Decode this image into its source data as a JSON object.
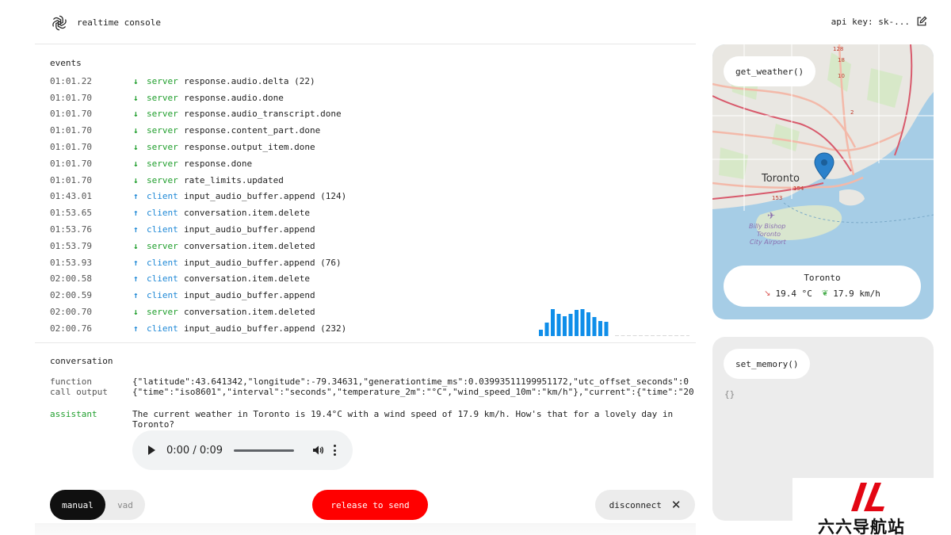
{
  "header": {
    "title": "realtime console",
    "api_key_label": "api key: sk-..."
  },
  "events": {
    "section_label": "events",
    "rows": [
      {
        "time": "01:01.22",
        "direction": "down",
        "source": "server",
        "type": "response.audio.delta (22)"
      },
      {
        "time": "01:01.70",
        "direction": "down",
        "source": "server",
        "type": "response.audio.done"
      },
      {
        "time": "01:01.70",
        "direction": "down",
        "source": "server",
        "type": "response.audio_transcript.done"
      },
      {
        "time": "01:01.70",
        "direction": "down",
        "source": "server",
        "type": "response.content_part.done"
      },
      {
        "time": "01:01.70",
        "direction": "down",
        "source": "server",
        "type": "response.output_item.done"
      },
      {
        "time": "01:01.70",
        "direction": "down",
        "source": "server",
        "type": "response.done"
      },
      {
        "time": "01:01.70",
        "direction": "down",
        "source": "server",
        "type": "rate_limits.updated"
      },
      {
        "time": "01:43.01",
        "direction": "up",
        "source": "client",
        "type": "input_audio_buffer.append (124)"
      },
      {
        "time": "01:53.65",
        "direction": "up",
        "source": "client",
        "type": "conversation.item.delete"
      },
      {
        "time": "01:53.76",
        "direction": "up",
        "source": "client",
        "type": "input_audio_buffer.append"
      },
      {
        "time": "01:53.79",
        "direction": "down",
        "source": "server",
        "type": "conversation.item.deleted"
      },
      {
        "time": "01:53.93",
        "direction": "up",
        "source": "client",
        "type": "input_audio_buffer.append (76)"
      },
      {
        "time": "02:00.58",
        "direction": "up",
        "source": "client",
        "type": "conversation.item.delete"
      },
      {
        "time": "02:00.59",
        "direction": "up",
        "source": "client",
        "type": "input_audio_buffer.append"
      },
      {
        "time": "02:00.70",
        "direction": "down",
        "source": "server",
        "type": "conversation.item.deleted"
      },
      {
        "time": "02:00.76",
        "direction": "up",
        "source": "client",
        "type": "input_audio_buffer.append (232)"
      }
    ]
  },
  "conversation": {
    "section_label": "conversation",
    "function_output": {
      "role": "function\ncall output",
      "line1": "{\"latitude\":43.641342,\"longitude\":-79.34631,\"generationtime_ms\":0.03993511199951172,\"utc_offset_seconds\":0",
      "line2": "{\"time\":\"iso8601\",\"interval\":\"seconds\",\"temperature_2m\":\"°C\",\"wind_speed_10m\":\"km/h\"},\"current\":{\"time\":\"20"
    },
    "assistant": {
      "role": "assistant",
      "text": "The current weather in Toronto is 19.4°C with a wind speed of 17.9 km/h. How's that for a lovely day in Toronto?"
    },
    "audio": {
      "time": "0:00 / 0:09",
      "progress": 0
    }
  },
  "controls": {
    "mode_manual": "manual",
    "mode_vad": "vad",
    "active_mode": "manual",
    "release_label": "release to send",
    "disconnect_label": "disconnect"
  },
  "weather_tool": {
    "label": "get_weather()",
    "map_city": "Toronto",
    "map_labels": [
      "Billy Bishop",
      "Toronto",
      "City Airport"
    ],
    "road_labels": [
      "128",
      "18",
      "10",
      "2",
      "154",
      "153"
    ],
    "city": "Toronto",
    "temperature": "19.4 °C",
    "wind": "17.9 km/h"
  },
  "memory_tool": {
    "label": "set_memory()",
    "value": "{}"
  },
  "watermark": {
    "text": "六六导航站"
  },
  "colors": {
    "server": "#1f9e2c",
    "client": "#1e88d6",
    "record_button": "#ff0000",
    "visualizer": "#0f8ee9"
  }
}
